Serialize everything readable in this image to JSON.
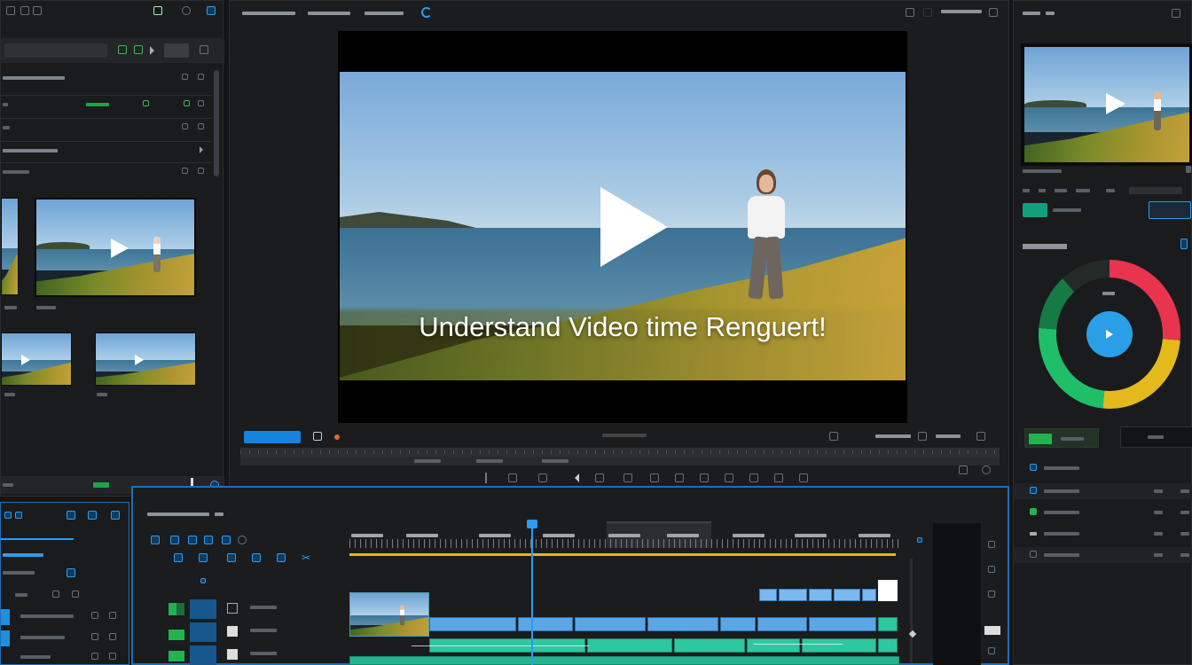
{
  "viewer": {
    "caption": "Understand Video time Renguert!"
  },
  "colors": {
    "accent_blue": "#1583e0",
    "accent_green": "#1fa34a",
    "teal_clip": "#2fc7a0",
    "blue_clip": "#5aa7e8",
    "playhead": "#2c9cf0",
    "ring_red": "#e8344f",
    "ring_yellow": "#e3b91b",
    "ring_green": "#1fbf6a",
    "ring_dark_green": "#167a45"
  },
  "icons": {
    "play": "play-icon",
    "record": "record-icon",
    "settings": "gear-icon"
  }
}
